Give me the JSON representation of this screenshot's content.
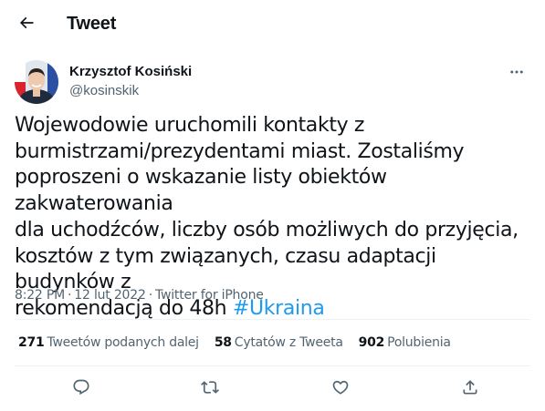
{
  "header": {
    "title": "Tweet",
    "back_icon": "arrow-left-icon"
  },
  "author": {
    "name": "Krzysztof Kosiński",
    "handle": "@kosinskik",
    "more_icon": "more-dots-icon"
  },
  "tweet": {
    "lines": [
      "Wojewodowie uruchomili kontakty z",
      "burmistrzami/prezydentami miast. Zostaliśmy",
      "poproszeni o wskazanie listy obiektów zakwaterowania",
      "dla uchodźców, liczby osób możliwych do przyjęcia,",
      "kosztów z tym związanych, czasu adaptacji budynków z",
      "rekomendacją do 48h"
    ],
    "hashtag": "#Ukraina",
    "time": "8:22 PM",
    "date": "12 lut 2022",
    "source": "Twitter for iPhone",
    "separator": "·"
  },
  "stats": {
    "retweets_count": "271",
    "retweets_label": "Tweetów podanych dalej",
    "quotes_count": "58",
    "quotes_label": "Cytatów z Tweeta",
    "likes_count": "902",
    "likes_label": "Polubienia"
  },
  "actions": {
    "reply_icon": "reply-icon",
    "retweet_icon": "retweet-icon",
    "like_icon": "heart-icon",
    "share_icon": "share-icon"
  },
  "colors": {
    "text": "#0f1419",
    "secondary": "#536471",
    "link": "#1d9bf0",
    "divider": "#eff3f4"
  }
}
